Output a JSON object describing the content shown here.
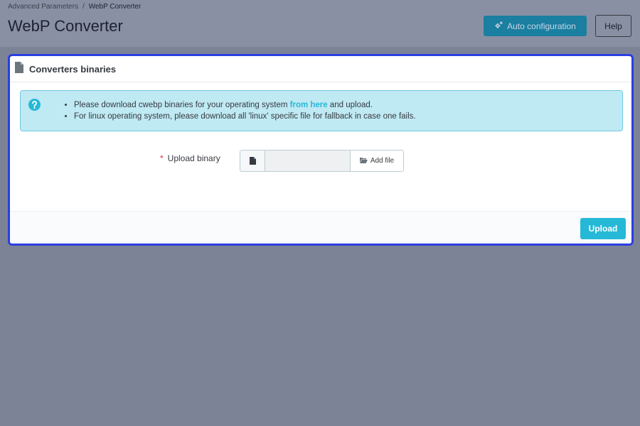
{
  "breadcrumb": {
    "parent": "Advanced Parameters",
    "separator": "/",
    "current": "WebP Converter"
  },
  "page_title": "WebP Converter",
  "toolbar": {
    "auto_config_label": "Auto configuration",
    "help_label": "Help"
  },
  "card": {
    "title": "Converters binaries",
    "alert": {
      "line1_before": "Please download cwebp binaries for your operating system ",
      "line1_link": "from here",
      "line1_after": " and upload.",
      "line2": "For linux operating system, please download all 'linux' specific file for fallback in case one fails."
    },
    "form": {
      "required_mark": "*",
      "upload_label": "Upload binary",
      "file_value": "",
      "add_file_label": "Add file"
    },
    "upload_button": "Upload"
  },
  "colors": {
    "accent": "#25b9d7",
    "auto_button": "#1a7fa0",
    "card_border": "#2a3fe0",
    "alert_bg": "#bfe9f3",
    "overlay_bg": "#7d8397"
  },
  "icons": {
    "card_header": "file-icon",
    "alert": "question-circle-icon",
    "auto_config": "cogs-icon",
    "file_field": "file-icon",
    "add_file": "folder-open-icon"
  }
}
